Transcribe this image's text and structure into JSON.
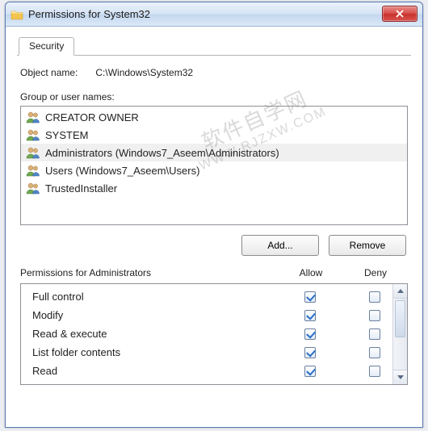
{
  "window": {
    "title": "Permissions for System32"
  },
  "tab": {
    "label": "Security"
  },
  "object": {
    "label": "Object name:",
    "value": "C:\\Windows\\System32"
  },
  "groups": {
    "label": "Group or user names:",
    "items": [
      {
        "name": "CREATOR OWNER",
        "selected": false
      },
      {
        "name": "SYSTEM",
        "selected": false
      },
      {
        "name": "Administrators (Windows7_Aseem\\Administrators)",
        "selected": true
      },
      {
        "name": "Users (Windows7_Aseem\\Users)",
        "selected": false
      },
      {
        "name": "TrustedInstaller",
        "selected": false
      }
    ]
  },
  "buttons": {
    "add": "Add...",
    "remove": "Remove"
  },
  "perm": {
    "label": "Permissions for Administrators",
    "allow": "Allow",
    "deny": "Deny",
    "rows": [
      {
        "name": "Full control",
        "allow": true,
        "deny": false
      },
      {
        "name": "Modify",
        "allow": true,
        "deny": false
      },
      {
        "name": "Read & execute",
        "allow": true,
        "deny": false
      },
      {
        "name": "List folder contents",
        "allow": true,
        "deny": false
      },
      {
        "name": "Read",
        "allow": true,
        "deny": false
      }
    ]
  },
  "watermark": {
    "line1": "软件自学网",
    "line2": "WWW.RJZXW.COM"
  }
}
